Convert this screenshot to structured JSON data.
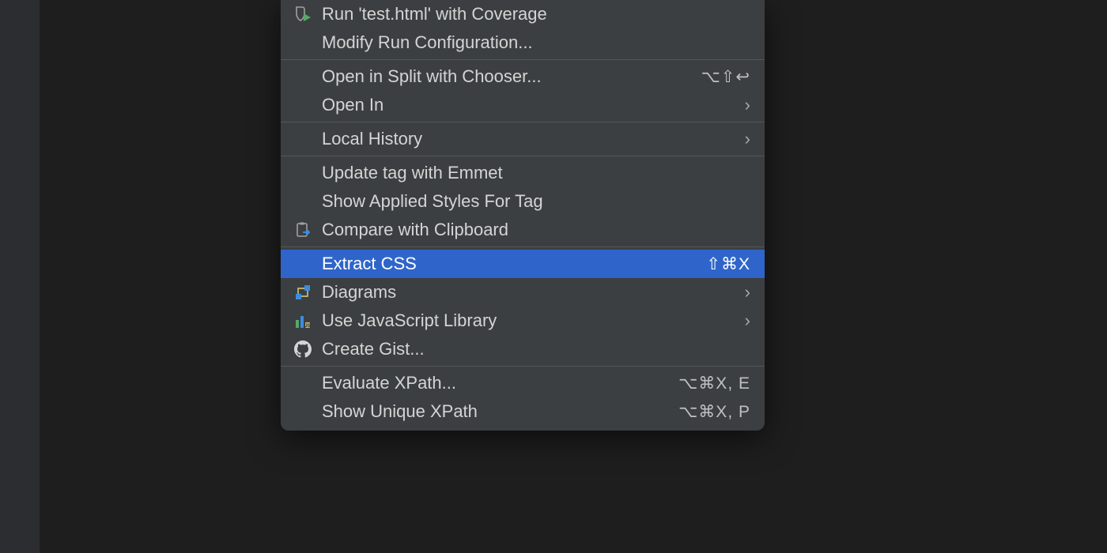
{
  "menu": {
    "groups": [
      [
        {
          "label": "Run 'test.html' with Coverage",
          "icon": "run-coverage-icon",
          "shortcut": "",
          "submenu": false
        },
        {
          "label": "Modify Run Configuration...",
          "icon": null,
          "shortcut": "",
          "submenu": false
        }
      ],
      [
        {
          "label": "Open in Split with Chooser...",
          "icon": null,
          "shortcut": "⌥⇧↩",
          "submenu": false
        },
        {
          "label": "Open In",
          "icon": null,
          "shortcut": "",
          "submenu": true
        }
      ],
      [
        {
          "label": "Local History",
          "icon": null,
          "shortcut": "",
          "submenu": true
        }
      ],
      [
        {
          "label": "Update tag with Emmet",
          "icon": null,
          "shortcut": "",
          "submenu": false
        },
        {
          "label": "Show Applied Styles For Tag",
          "icon": null,
          "shortcut": "",
          "submenu": false
        },
        {
          "label": "Compare with Clipboard",
          "icon": "clipboard-compare-icon",
          "shortcut": "",
          "submenu": false
        }
      ],
      [
        {
          "label": "Extract CSS",
          "icon": null,
          "shortcut": "⇧⌘X",
          "submenu": false,
          "highlight": true
        },
        {
          "label": "Diagrams",
          "icon": "diagrams-icon",
          "shortcut": "",
          "submenu": true
        },
        {
          "label": "Use JavaScript Library",
          "icon": "js-library-icon",
          "shortcut": "",
          "submenu": true
        },
        {
          "label": "Create Gist...",
          "icon": "github-icon",
          "shortcut": "",
          "submenu": false
        }
      ],
      [
        {
          "label": "Evaluate XPath...",
          "icon": null,
          "shortcut": "⌥⌘X, E",
          "submenu": false
        },
        {
          "label": "Show Unique XPath",
          "icon": null,
          "shortcut": "⌥⌘X, P",
          "submenu": false
        }
      ]
    ]
  }
}
